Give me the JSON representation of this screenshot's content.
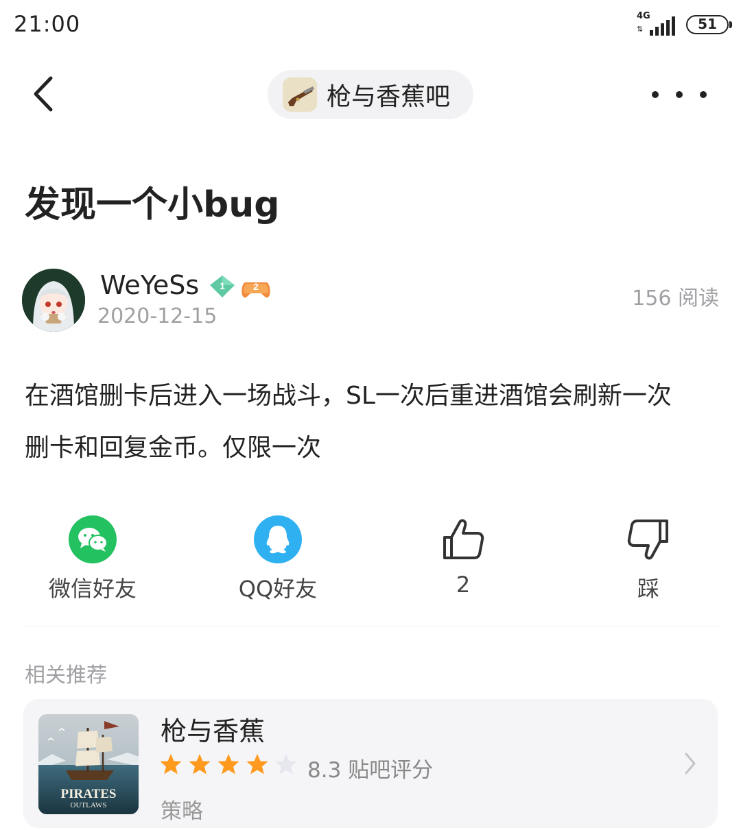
{
  "status_bar": {
    "time": "21:00",
    "network": "4G",
    "battery": "51"
  },
  "nav": {
    "forum_name": "枪与香蕉吧"
  },
  "post": {
    "title": "发现一个小bug",
    "author": "WeYeSs",
    "date": "2020-12-15",
    "read_count": "156 阅读",
    "body_line1": "在酒馆删卡后进入一场战斗，SL一次后重进酒馆会刷新一次",
    "body_line2": "删卡和回复金币。仅限一次",
    "badges": {
      "level": "1",
      "game_level": "2"
    }
  },
  "actions": {
    "wechat": "微信好友",
    "qq": "QQ好友",
    "like_count": "2",
    "dislike": "踩"
  },
  "recommend": {
    "header": "相关推荐",
    "game_name": "枪与香蕉",
    "rating": 8.3,
    "rating_text": "8.3 贴吧评分",
    "stars_filled": 4,
    "stars_total": 5,
    "tag": "策略",
    "cover_text_1": "PIRATES",
    "cover_text_2": "OUTLAWS"
  },
  "colors": {
    "wechat": "#24c160",
    "qq": "#2fb0f0",
    "star": "#ff9a1f",
    "star_empty": "#e6e6ee"
  }
}
